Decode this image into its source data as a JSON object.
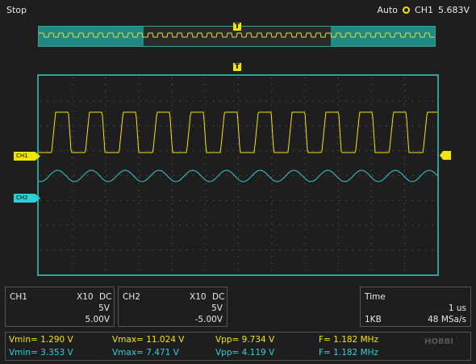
{
  "status": {
    "state": "Stop",
    "mode": "Auto",
    "trigger_source": "CH1",
    "trigger_level": "5.683V"
  },
  "markers": {
    "trigger_top": "T",
    "trigger_screen": "T",
    "ch1": "CH1",
    "ch2": "CH2"
  },
  "ch1_info": {
    "name": "CH1",
    "probe": "X10",
    "coupling": "DC",
    "volts_div": "5V",
    "offset": "5.00V"
  },
  "ch2_info": {
    "name": "CH2",
    "probe": "X10",
    "coupling": "DC",
    "volts_div": "5V",
    "offset": "-5.00V"
  },
  "time_info": {
    "label": "Time",
    "time_div": "1 us",
    "memory": "1KB",
    "sample_rate": "48 MSa/s"
  },
  "measurements": {
    "ch1": {
      "vmin": "Vmin= 1.290 V",
      "vmax": "Vmax= 11.024 V",
      "vpp": "Vpp= 9.734 V",
      "freq": "F= 1.182 MHz"
    },
    "ch2": {
      "vmin": "Vmin= 3.353 V",
      "vmax": "Vmax= 7.471 V",
      "vpp": "Vpp= 4.119 V",
      "freq": "F= 1.182 MHz"
    }
  },
  "logo_text": "HOBBI",
  "colors": {
    "ch1": "#f2e600",
    "ch2": "#2fcfd6",
    "frame": "#3a9c94"
  }
}
